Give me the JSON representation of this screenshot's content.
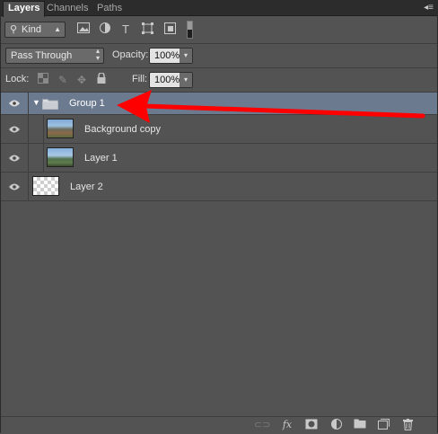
{
  "tabs": [
    {
      "label": "Layers",
      "active": true
    },
    {
      "label": "Channels",
      "active": false
    },
    {
      "label": "Paths",
      "active": false
    }
  ],
  "filter": {
    "kind_label": "Kind"
  },
  "blend": {
    "mode": "Pass Through",
    "opacity_label": "Opacity:",
    "opacity_value": "100%"
  },
  "lock": {
    "label": "Lock:",
    "fill_label": "Fill:",
    "fill_value": "100%"
  },
  "layers": [
    {
      "name": "Group 1",
      "type": "group",
      "selected": true,
      "visible": true
    },
    {
      "name": "Background copy",
      "type": "image",
      "visible": true
    },
    {
      "name": "Layer 1",
      "type": "image",
      "visible": true
    },
    {
      "name": "Layer 2",
      "type": "transparent",
      "visible": true
    }
  ],
  "icons": {
    "filter": [
      "image-filter-icon",
      "adjustment-filter-icon",
      "type-filter-icon",
      "shape-filter-icon",
      "smart-object-filter-icon"
    ],
    "lock": [
      "lock-transparent-icon",
      "lock-image-icon",
      "lock-position-icon",
      "lock-all-icon"
    ],
    "bottom": [
      "link-layers-icon",
      "fx-icon",
      "add-mask-icon",
      "adjustment-layer-icon",
      "new-group-icon",
      "new-layer-icon",
      "delete-layer-icon"
    ]
  },
  "colors": {
    "selected_row": "#6b7a8e",
    "annotation_arrow": "#ff0000",
    "panel_bg": "#535353"
  }
}
